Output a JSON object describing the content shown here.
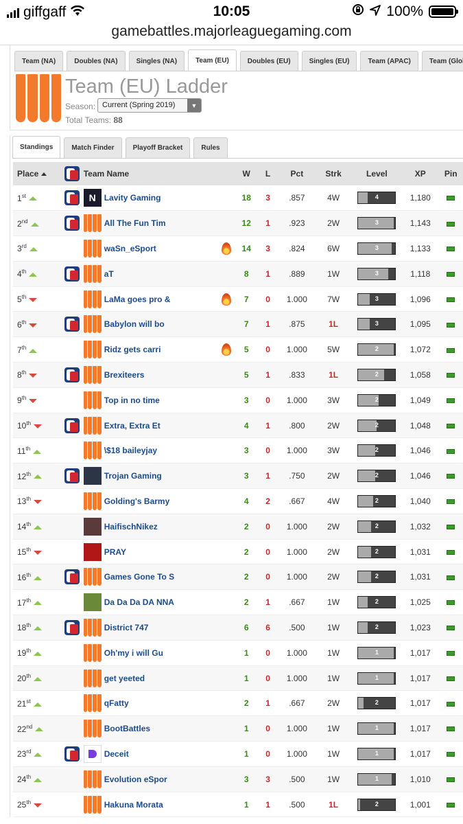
{
  "statusbar": {
    "carrier": "giffgaff",
    "time": "10:05",
    "battery": "100%"
  },
  "browser": {
    "url": "gamebattles.majorleaguegaming.com"
  },
  "ladder_tabs": [
    "Team (NA)",
    "Doubles (NA)",
    "Singles (NA)",
    "Team (EU)",
    "Doubles (EU)",
    "Singles (EU)",
    "Team (APAC)",
    "Team (Global)"
  ],
  "ladder": {
    "title": "Team (EU) Ladder",
    "season_label": "Season:",
    "season_value": "Current (Spring 2019)",
    "total_label": "Total Teams:",
    "total_value": "88"
  },
  "sub_tabs": [
    "Standings",
    "Match Finder",
    "Playoff Bracket",
    "Rules"
  ],
  "table": {
    "headers": {
      "place": "Place",
      "team": "Team Name",
      "w": "W",
      "l": "L",
      "pct": "Pct",
      "strk": "Strk",
      "level": "Level",
      "xp": "XP",
      "pin": "Pin"
    },
    "rows": [
      {
        "place": "1",
        "suffix": "st",
        "trend": "up",
        "region": true,
        "avatar": "dark",
        "avatar_text": "N",
        "name": "Lavity Gaming",
        "fire": false,
        "w": "18",
        "l": "3",
        "pct": ".857",
        "strk": "4W",
        "level": "4",
        "level_fill": 0.25,
        "xp": "1,180"
      },
      {
        "place": "2",
        "suffix": "nd",
        "trend": "up",
        "region": true,
        "avatar": "orange",
        "name": "All The Fun Tim",
        "fire": false,
        "w": "12",
        "l": "1",
        "pct": ".923",
        "strk": "2W",
        "level": "3",
        "level_fill": 0.95,
        "xp": "1,143"
      },
      {
        "place": "3",
        "suffix": "rd",
        "trend": "up",
        "region": false,
        "avatar": "orange",
        "name": "waSn_eSport",
        "fire": true,
        "w": "14",
        "l": "3",
        "pct": ".824",
        "strk": "6W",
        "level": "3",
        "level_fill": 0.9,
        "xp": "1,133"
      },
      {
        "place": "4",
        "suffix": "th",
        "trend": "up",
        "region": true,
        "avatar": "orange",
        "name": "aT",
        "fire": false,
        "w": "8",
        "l": "1",
        "pct": ".889",
        "strk": "1W",
        "level": "3",
        "level_fill": 0.8,
        "xp": "1,118"
      },
      {
        "place": "5",
        "suffix": "th",
        "trend": "down",
        "region": false,
        "avatar": "orange",
        "name": "LaMa goes pro &",
        "fire": true,
        "w": "7",
        "l": "0",
        "pct": "1.000",
        "strk": "7W",
        "level": "3",
        "level_fill": 0.3,
        "xp": "1,096"
      },
      {
        "place": "6",
        "suffix": "th",
        "trend": "down",
        "region": true,
        "avatar": "orange",
        "name": "Babylon will bo",
        "fire": false,
        "w": "7",
        "l": "1",
        "pct": ".875",
        "strk": "1L",
        "level": "3",
        "level_fill": 0.3,
        "xp": "1,095"
      },
      {
        "place": "7",
        "suffix": "th",
        "trend": "up",
        "region": false,
        "avatar": "orange",
        "name": "Ridz gets carri",
        "fire": true,
        "w": "5",
        "l": "0",
        "pct": "1.000",
        "strk": "5W",
        "level": "2",
        "level_fill": 0.95,
        "xp": "1,072"
      },
      {
        "place": "8",
        "suffix": "th",
        "trend": "down",
        "region": true,
        "avatar": "orange",
        "name": "Brexiteers",
        "fire": false,
        "w": "5",
        "l": "1",
        "pct": ".833",
        "strk": "1L",
        "level": "2",
        "level_fill": 0.7,
        "xp": "1,058"
      },
      {
        "place": "9",
        "suffix": "th",
        "trend": "down",
        "region": false,
        "avatar": "orange",
        "name": "Top in no time",
        "fire": false,
        "w": "3",
        "l": "0",
        "pct": "1.000",
        "strk": "3W",
        "level": "2",
        "level_fill": 0.55,
        "xp": "1,049"
      },
      {
        "place": "10",
        "suffix": "th",
        "trend": "down",
        "region": true,
        "avatar": "orange",
        "name": "Extra, Extra Et",
        "fire": false,
        "w": "4",
        "l": "1",
        "pct": ".800",
        "strk": "2W",
        "level": "2",
        "level_fill": 0.5,
        "xp": "1,048"
      },
      {
        "place": "11",
        "suffix": "th",
        "trend": "up",
        "region": false,
        "avatar": "orange",
        "name": "\\$18 baileyjay",
        "fire": false,
        "w": "3",
        "l": "0",
        "pct": "1.000",
        "strk": "3W",
        "level": "2",
        "level_fill": 0.45,
        "xp": "1,046"
      },
      {
        "place": "12",
        "suffix": "th",
        "trend": "up",
        "region": true,
        "avatar": "trojan",
        "name": "Trojan Gaming",
        "fire": false,
        "w": "3",
        "l": "1",
        "pct": ".750",
        "strk": "2W",
        "level": "2",
        "level_fill": 0.45,
        "xp": "1,046"
      },
      {
        "place": "13",
        "suffix": "th",
        "trend": "down",
        "region": false,
        "avatar": "orange",
        "name": "Golding's Barmy",
        "fire": false,
        "w": "4",
        "l": "2",
        "pct": ".667",
        "strk": "4W",
        "level": "2",
        "level_fill": 0.4,
        "xp": "1,040"
      },
      {
        "place": "14",
        "suffix": "th",
        "trend": "up",
        "region": false,
        "avatar": "photo",
        "name": "HaifischNikez",
        "fire": false,
        "w": "2",
        "l": "0",
        "pct": "1.000",
        "strk": "2W",
        "level": "2",
        "level_fill": 0.35,
        "xp": "1,032"
      },
      {
        "place": "15",
        "suffix": "th",
        "trend": "down",
        "region": false,
        "avatar": "red",
        "name": "PRAY",
        "fire": false,
        "w": "2",
        "l": "0",
        "pct": "1.000",
        "strk": "2W",
        "level": "2",
        "level_fill": 0.35,
        "xp": "1,031"
      },
      {
        "place": "16",
        "suffix": "th",
        "trend": "up",
        "region": true,
        "avatar": "orange",
        "name": "Games Gone To S",
        "fire": false,
        "w": "2",
        "l": "0",
        "pct": "1.000",
        "strk": "2W",
        "level": "2",
        "level_fill": 0.35,
        "xp": "1,031"
      },
      {
        "place": "17",
        "suffix": "th",
        "trend": "up",
        "region": false,
        "avatar": "green",
        "name": "Da Da Da DA NNA",
        "fire": false,
        "w": "2",
        "l": "1",
        "pct": ".667",
        "strk": "1W",
        "level": "2",
        "level_fill": 0.25,
        "xp": "1,025"
      },
      {
        "place": "18",
        "suffix": "th",
        "trend": "up",
        "region": true,
        "avatar": "orange",
        "name": "District 747",
        "fire": false,
        "w": "6",
        "l": "6",
        "pct": ".500",
        "strk": "1W",
        "level": "2",
        "level_fill": 0.25,
        "xp": "1,023"
      },
      {
        "place": "19",
        "suffix": "th",
        "trend": "up",
        "region": false,
        "avatar": "orange",
        "name": "Oh'my i will Gu",
        "fire": false,
        "w": "1",
        "l": "0",
        "pct": "1.000",
        "strk": "1W",
        "level": "1",
        "level_fill": 0.95,
        "xp": "1,017"
      },
      {
        "place": "20",
        "suffix": "th",
        "trend": "up",
        "region": false,
        "avatar": "orange",
        "name": "get yeeted",
        "fire": false,
        "w": "1",
        "l": "0",
        "pct": "1.000",
        "strk": "1W",
        "level": "1",
        "level_fill": 0.95,
        "xp": "1,017"
      },
      {
        "place": "21",
        "suffix": "st",
        "trend": "up",
        "region": false,
        "avatar": "orange",
        "name": "qFatty",
        "fire": false,
        "w": "2",
        "l": "1",
        "pct": ".667",
        "strk": "2W",
        "level": "2",
        "level_fill": 0.15,
        "xp": "1,017"
      },
      {
        "place": "22",
        "suffix": "nd",
        "trend": "up",
        "region": false,
        "avatar": "orange",
        "name": "BootBattles",
        "fire": false,
        "w": "1",
        "l": "0",
        "pct": "1.000",
        "strk": "1W",
        "level": "1",
        "level_fill": 0.95,
        "xp": "1,017"
      },
      {
        "place": "23",
        "suffix": "rd",
        "trend": "up",
        "region": true,
        "avatar": "deceit",
        "name": "Deceit",
        "fire": false,
        "w": "1",
        "l": "0",
        "pct": "1.000",
        "strk": "1W",
        "level": "1",
        "level_fill": 0.95,
        "xp": "1,017"
      },
      {
        "place": "24",
        "suffix": "th",
        "trend": "up",
        "region": false,
        "avatar": "orange",
        "name": "Evolution eSpor",
        "fire": false,
        "w": "3",
        "l": "3",
        "pct": ".500",
        "strk": "1W",
        "level": "1",
        "level_fill": 0.9,
        "xp": "1,010"
      },
      {
        "place": "25",
        "suffix": "th",
        "trend": "down",
        "region": false,
        "avatar": "orange",
        "name": "Hakuna Morata",
        "fire": false,
        "w": "1",
        "l": "1",
        "pct": ".500",
        "strk": "1L",
        "level": "2",
        "level_fill": 0.05,
        "xp": "1,001"
      }
    ]
  }
}
